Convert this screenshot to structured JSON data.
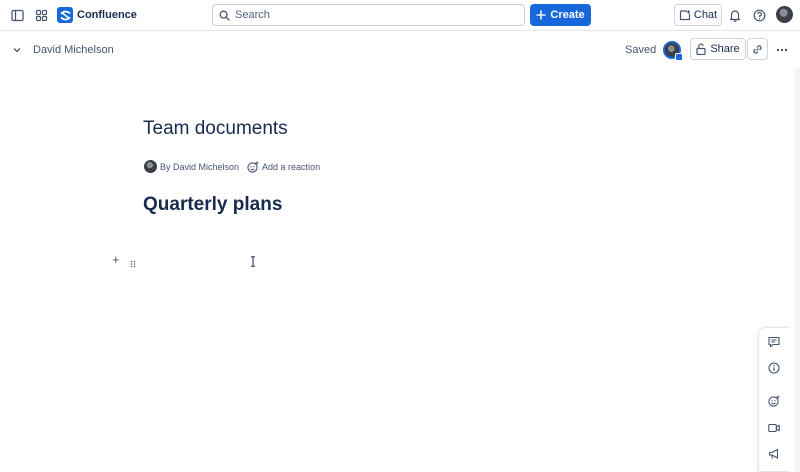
{
  "topbar": {
    "brand": "Confluence",
    "search_placeholder": "Search",
    "create_label": "Create",
    "chat_label": "Chat"
  },
  "pagebar": {
    "breadcrumb": "David Michelson",
    "status": "Saved",
    "share_label": "Share"
  },
  "content": {
    "title": "Team documents",
    "byline": "By David Michelson",
    "reaction_label": "Add a reaction",
    "heading": "Quarterly plans"
  },
  "icons": {
    "sidebar_toggle": "sidebar-toggle-icon",
    "app_switcher": "app-switcher-icon",
    "search": "search-icon",
    "notifications": "bell-icon",
    "help": "help-icon",
    "rail": [
      "comment-icon",
      "info-icon",
      "emoji-icon",
      "video-icon",
      "megaphone-icon"
    ]
  },
  "colors": {
    "brand_blue": "#1868db",
    "text": "#172b4d",
    "subtle_text": "#44546f",
    "border": "#d0d4da"
  }
}
